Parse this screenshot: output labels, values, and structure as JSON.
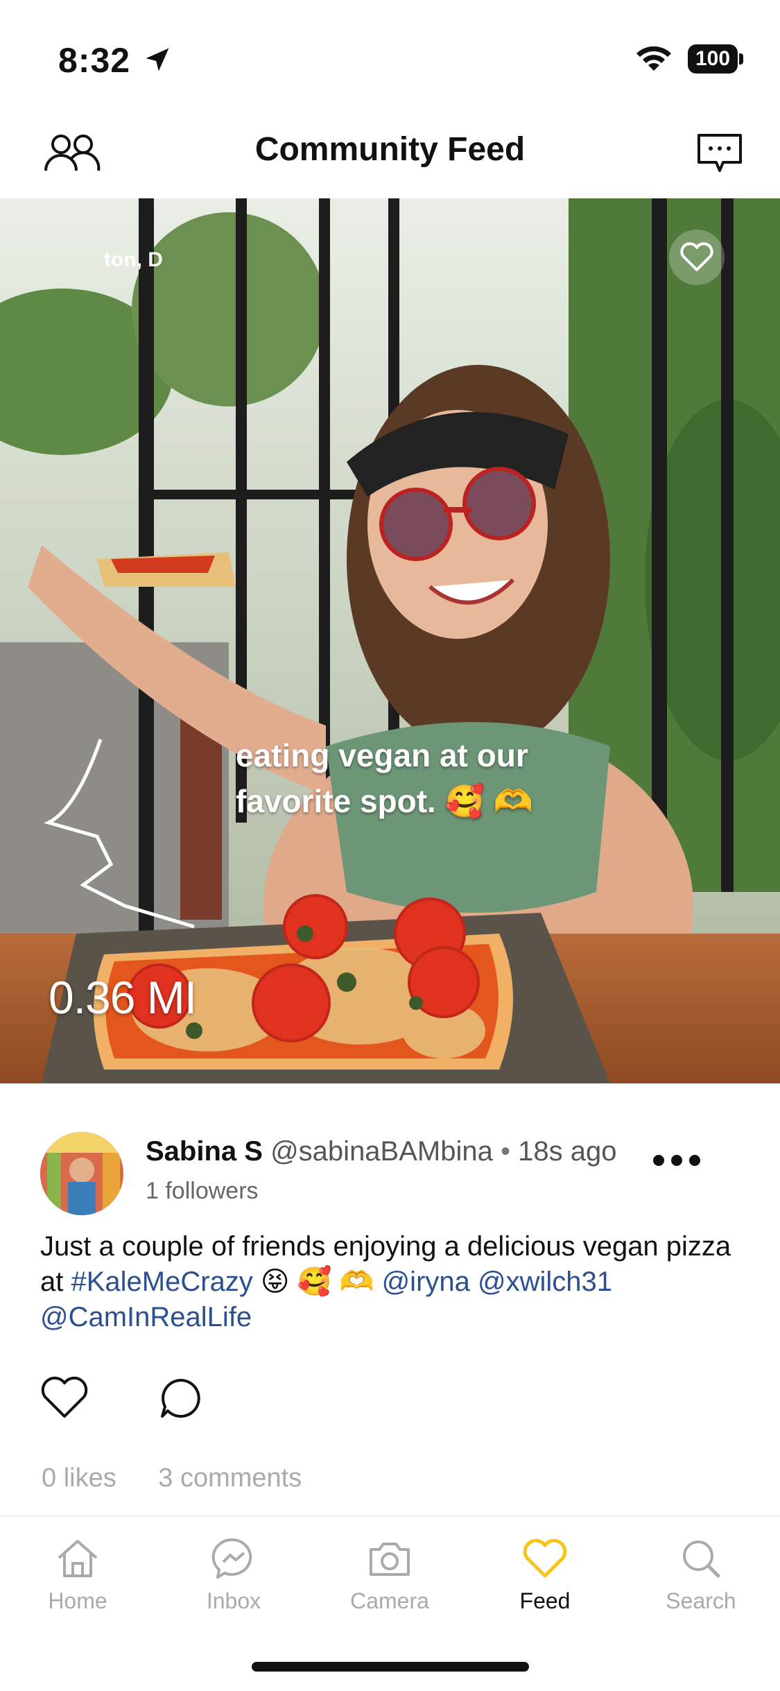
{
  "status": {
    "time": "8:32",
    "battery": "100"
  },
  "header": {
    "title": "Community Feed"
  },
  "media": {
    "location_label": "ton, D",
    "caption_line1": "eating vegan at our",
    "caption_line2": "favorite spot. 🥰 🫶",
    "distance": "0.36 MI"
  },
  "post": {
    "name": "Sabina S",
    "handle": "@sabinaBAMbina",
    "separator": "•",
    "ago": "18s ago",
    "followers": "1 followers",
    "text_start": "Just a couple of friends enjoying a delicious vegan pizza at ",
    "hashtag": "#KaleMeCrazy",
    "emojis": " 😝 🥰 🫶 ",
    "mention1": "@iryna",
    "mention2": "@xwilch31",
    "mention3": "@CamInRealLife",
    "likes": "0 likes",
    "comments": "3 comments"
  },
  "tabs": [
    {
      "label": "Home",
      "icon": "home-icon"
    },
    {
      "label": "Inbox",
      "icon": "messenger-icon"
    },
    {
      "label": "Camera",
      "icon": "camera-icon"
    },
    {
      "label": "Feed",
      "icon": "heart-icon",
      "active": true
    },
    {
      "label": "Search",
      "icon": "search-icon"
    }
  ],
  "colors": {
    "accent": "#f5c518",
    "link": "#2c4f8f"
  }
}
